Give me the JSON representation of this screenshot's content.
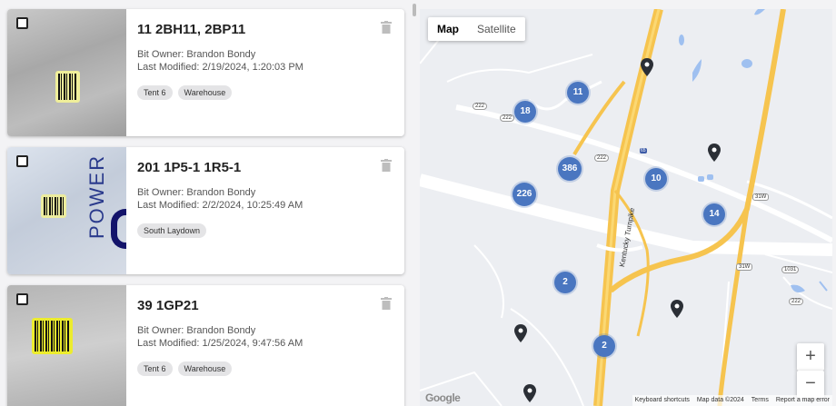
{
  "items": [
    {
      "title": "11 2BH11, 2BP11",
      "owner": "Bit Owner: Brandon Bondy",
      "modified": "Last Modified: 2/19/2024, 1:20:03 PM",
      "tags": [
        "Tent 6",
        "Warehouse"
      ]
    },
    {
      "title": "201 1P5-1 1R5-1",
      "owner": "Bit Owner: Brandon Bondy",
      "modified": "Last Modified: 2/2/2024, 10:25:49 AM",
      "tags": [
        "South Laydown"
      ]
    },
    {
      "title": "39 1GP21",
      "owner": "Bit Owner: Brandon Bondy",
      "modified": "Last Modified: 1/25/2024, 9:47:56 AM",
      "tags": [
        "Tent 6",
        "Warehouse"
      ]
    }
  ],
  "thumbnail_text": "POWER",
  "map": {
    "type_map": "Map",
    "type_satellite": "Satellite",
    "clusters": [
      "11",
      "18",
      "386",
      "10",
      "226",
      "14",
      "2",
      "2"
    ],
    "road_labels": {
      "turnpike": "Kentucky Turnpike",
      "r222a": "222",
      "r222b": "222",
      "r222c": "222",
      "r222d": "222",
      "r31w_a": "31W",
      "r31w_b": "31W",
      "r1031": "1031",
      "i65": "65"
    },
    "zoom_in": "+",
    "zoom_out": "−",
    "google": "Google",
    "footer": {
      "shortcuts": "Keyboard shortcuts",
      "data": "Map data ©2024",
      "terms": "Terms",
      "report": "Report a map error"
    }
  },
  "colors": {
    "cluster": "#4a76c0",
    "highway": "#f6c44f",
    "water": "#9fc0f0"
  }
}
